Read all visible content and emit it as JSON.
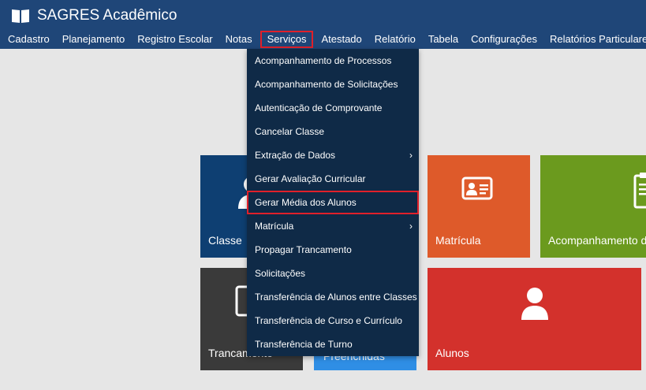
{
  "app": {
    "title": "SAGRES Acadêmico"
  },
  "nav": [
    {
      "id": "cadastro",
      "label": "Cadastro"
    },
    {
      "id": "planejamento",
      "label": "Planejamento"
    },
    {
      "id": "registro-escolar",
      "label": "Registro Escolar"
    },
    {
      "id": "notas",
      "label": "Notas"
    },
    {
      "id": "servicos",
      "label": "Serviços"
    },
    {
      "id": "atestado",
      "label": "Atestado"
    },
    {
      "id": "relatorio",
      "label": "Relatório"
    },
    {
      "id": "tabela",
      "label": "Tabela"
    },
    {
      "id": "configuracoes",
      "label": "Configurações"
    },
    {
      "id": "relatorios-particulares",
      "label": "Relatórios Particulares"
    }
  ],
  "dropdown": {
    "items": [
      {
        "label": "Acompanhamento de Processos"
      },
      {
        "label": "Acompanhamento de Solicitações"
      },
      {
        "label": "Autenticação de Comprovante"
      },
      {
        "label": "Cancelar Classe"
      },
      {
        "label": "Extração de Dados",
        "submenu": "›"
      },
      {
        "label": "Gerar Avaliação Curricular"
      },
      {
        "label": "Gerar Média dos Alunos"
      },
      {
        "label": "Matrícula",
        "submenu": "›"
      },
      {
        "label": "Propagar Trancamento"
      },
      {
        "label": "Solicitações"
      },
      {
        "label": "Transferência de Alunos entre Classes"
      },
      {
        "label": "Transferência de Curso e Currículo"
      },
      {
        "label": "Transferência de Turno"
      }
    ]
  },
  "tiles": {
    "classe": {
      "label": "Classe",
      "color": "#0e3f72"
    },
    "matricula": {
      "label": "Matrícula",
      "color": "#de5a2a"
    },
    "acompanhamento": {
      "label": "Acompanhamento d",
      "color": "#6b9a1e"
    },
    "trancamento": {
      "label": "Trancamento",
      "color": "#3a3a3a"
    },
    "preenchidas": {
      "label": "Preenchidas",
      "color": "#2f8ee5"
    },
    "alunos": {
      "label": "Alunos",
      "color": "#d3312c"
    }
  },
  "colors": {
    "header": "#1f4678",
    "dropdown": "#0f2a47",
    "highlight_border": "#e0202a",
    "background": "#e6e6e6"
  }
}
